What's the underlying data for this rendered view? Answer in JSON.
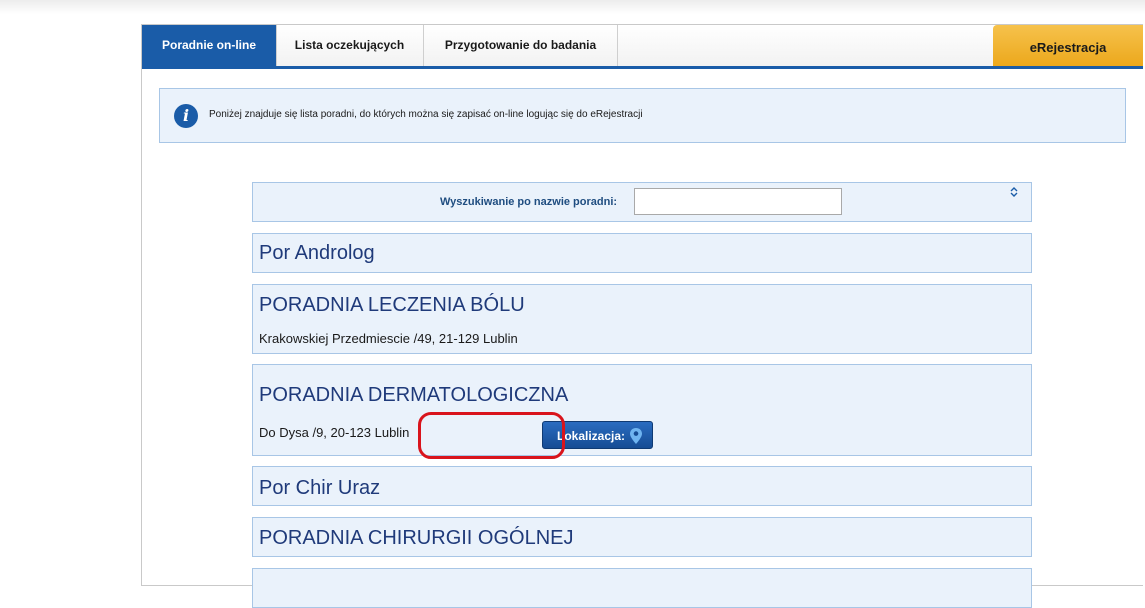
{
  "tabs": [
    "Poradnie on-line",
    "Lista oczekujących",
    "Przygotowanie do badania"
  ],
  "ereg_label": "eRejestracja",
  "info": {
    "icon": "info-icon",
    "glyph": "i",
    "text": "Poniżej znajduje się lista poradni, do których można się zapisać on-line logując się do eRejestracji"
  },
  "search": {
    "label": "Wyszukiwanie po nazwie poradni:",
    "value": "",
    "toggle_icon": "sort-chevrons-icon"
  },
  "clinics": [
    {
      "name": "Por Androlog"
    },
    {
      "name": "PORADNIA LECZENIA BÓLU",
      "address": "Krakowskiej Przedmiescie /49, 21-129 Lublin"
    },
    {
      "name": "PORADNIA DERMATOLOGICZNA",
      "address": "Do Dysa /9, 20-123 Lublin",
      "location_button": "Lokalizacja:",
      "location_icon": "map-pin-icon"
    },
    {
      "name": "Por Chir Uraz"
    },
    {
      "name": "PORADNIA CHIRURGII OGÓLNEJ"
    }
  ],
  "colors": {
    "accent": "#1a5ca8",
    "ereg": "#f0b02a",
    "card_bg": "#eaf2fb",
    "card_border": "#a8c6e6",
    "highlight": "#d9141c"
  }
}
